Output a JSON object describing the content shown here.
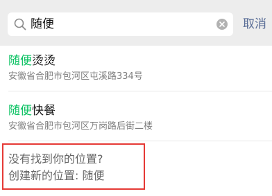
{
  "search": {
    "value": "随便",
    "cancel_label": "取消"
  },
  "results": [
    {
      "highlight": "随便",
      "rest": "烫烫",
      "address": "安徽省合肥市包河区屯溪路334号"
    },
    {
      "highlight": "随便",
      "rest": "快餐",
      "address": "安徽省合肥市包河区万岗路后街二楼"
    }
  ],
  "create": {
    "not_found": "没有找到你的位置?",
    "create_new": "创建新的位置: 随便"
  },
  "colors": {
    "highlight": "#07c160",
    "cancel": "#576b95",
    "annotation_box": "#e53935"
  }
}
